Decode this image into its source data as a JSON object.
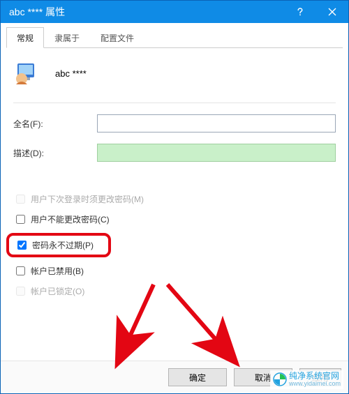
{
  "titlebar": {
    "title": "abc **** 属性"
  },
  "tabs": [
    {
      "label": "常规",
      "active": true
    },
    {
      "label": "隶属于",
      "active": false
    },
    {
      "label": "配置文件",
      "active": false
    }
  ],
  "user": {
    "display_name": "abc ****"
  },
  "fields": {
    "fullname": {
      "label": "全名(F):",
      "value": ""
    },
    "description": {
      "label": "描述(D):",
      "value": ""
    }
  },
  "checkboxes": {
    "must_change": {
      "label": "用户下次登录时须更改密码(M)",
      "checked": false,
      "disabled": true
    },
    "cannot_change": {
      "label": "用户不能更改密码(C)",
      "checked": false,
      "disabled": false
    },
    "never_expires": {
      "label": "密码永不过期(P)",
      "checked": true,
      "disabled": false
    },
    "disabled": {
      "label": "帐户已禁用(B)",
      "checked": false,
      "disabled": false
    },
    "locked": {
      "label": "帐户已锁定(O)",
      "checked": false,
      "disabled": true
    }
  },
  "buttons": {
    "ok": "确定",
    "cancel": "取消",
    "apply": "应用"
  },
  "watermark": {
    "name": "纯净系统官网",
    "url": "www.yidaimei.com"
  }
}
